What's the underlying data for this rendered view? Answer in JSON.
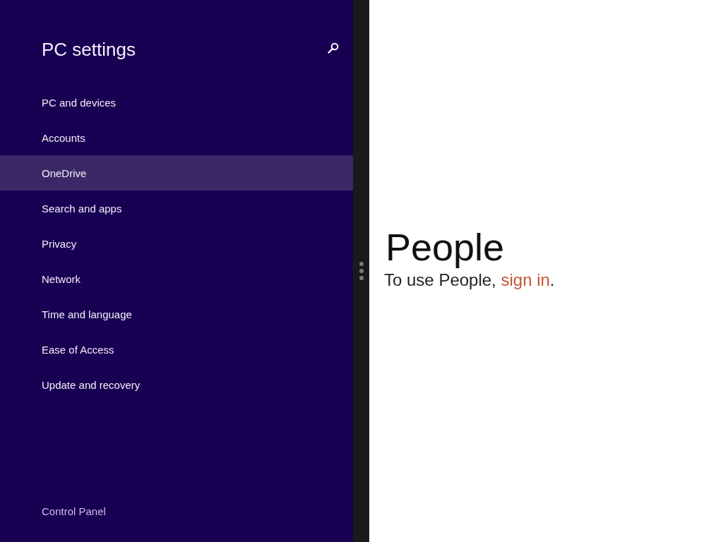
{
  "settings_pane": {
    "title": "PC settings",
    "nav_items": [
      {
        "label": "PC and devices",
        "selected": false
      },
      {
        "label": "Accounts",
        "selected": false
      },
      {
        "label": "OneDrive",
        "selected": true
      },
      {
        "label": "Search and apps",
        "selected": false
      },
      {
        "label": "Privacy",
        "selected": false
      },
      {
        "label": "Network",
        "selected": false
      },
      {
        "label": "Time and language",
        "selected": false
      },
      {
        "label": "Ease of Access",
        "selected": false
      },
      {
        "label": "Update and recovery",
        "selected": false
      }
    ],
    "footer_link": "Control Panel"
  },
  "app_pane": {
    "heading": "People",
    "message": {
      "before": "To use People, ",
      "link": "sign in",
      "after": "."
    }
  }
}
